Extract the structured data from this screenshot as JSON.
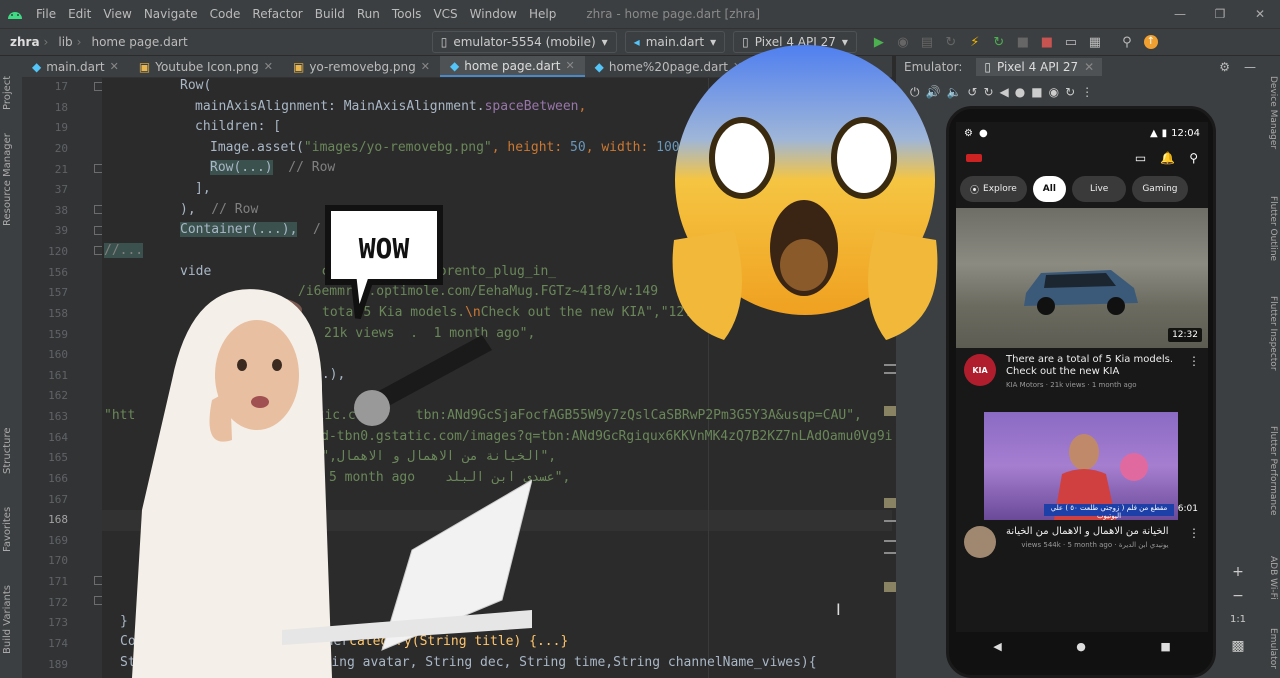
{
  "menubar": {
    "items": [
      "File",
      "Edit",
      "View",
      "Navigate",
      "Code",
      "Refactor",
      "Build",
      "Run",
      "Tools",
      "VCS",
      "Window",
      "Help"
    ],
    "window_title": "zhra - home page.dart [zhra]"
  },
  "navbar": {
    "project": "zhra",
    "folder": "lib",
    "file": "home page.dart",
    "device_selector": "emulator-5554 (mobile)",
    "run_config": "main.dart",
    "avd": "Pixel 4 API 27"
  },
  "tabs": [
    {
      "label": "main.dart",
      "active": false
    },
    {
      "label": "Youtube Icon.png",
      "active": false
    },
    {
      "label": "yo-removebg.png",
      "active": false
    },
    {
      "label": "home page.dart",
      "active": true
    },
    {
      "label": "home%20page.dart",
      "active": false
    }
  ],
  "left_strip": {
    "project": "Project",
    "resource_manager": "Resource Manager",
    "structure": "Structure",
    "favorites": "Favorites",
    "build_variants": "Build Variants"
  },
  "right_strip": {
    "device_manager": "Device Manager",
    "flutter_outline": "Flutter Outline",
    "flutter_inspector": "Flutter Inspector",
    "flutter_performance": "Flutter Performance",
    "adb_wifi": "ADB Wi-Fi",
    "emulator": "Emulator"
  },
  "editor": {
    "line_numbers": [
      "17",
      "18",
      "19",
      "20",
      "21",
      "37",
      "38",
      "39",
      "120",
      "156",
      "157",
      "158",
      "159",
      "160",
      "161",
      "162",
      "163",
      "164",
      "165",
      "166",
      "167",
      "168",
      "169",
      "170",
      "171",
      "172",
      "173",
      "174",
      "189"
    ],
    "current_line": "168",
    "lines": {
      "l17": "Row(",
      "l18_a": "mainAxisAlignment: MainAxisAlignment.",
      "l18_b": "spaceBetween",
      "l18_c": ",",
      "l19": "children: [",
      "l20_a": "Image.asset(",
      "l20_b": "\"images/yo-removebg.png\"",
      "l20_c": ", height: ",
      "l20_d": "50",
      "l20_e": ", width: ",
      "l20_f": "100",
      "l20_g": ")",
      "l21_a": "Row(...)",
      "l21_b": "  // Row",
      "l37": "],",
      "l38_a": "),",
      "l38_b": "  // Row",
      "l39_a": "Container(...),",
      "l39_b": "  /",
      "l120": "//...",
      "l156_a": "vide",
      "l156_b": "com/walls/kia_sorento_plug_in_",
      "l157": "/i6emmr.i.optimole.com/EehaMug.FGTz~41f8/w:149",
      "l158_a": "tota",
      "l158_b": "5 Kia models.",
      "l158_c": "\\n",
      "l158_d": "Check out the new KIA\",\"12.",
      "l159": "21k views  .  1 month ago\",",
      "l161": "0.),",
      "l163_a": "\"htt",
      "l163_b": "gstatic.c",
      "l163_c": "tbn:ANd9GcSjaFocfAGB55W9y7zQslCaSBRwP2Pm3G5Y3A&usqp=CAU\",",
      "l164": "rypted-tbn0.gstatic.com/images?q=tbn:ANd9GcRgiqux6KKVnMK4zQ7B2KZ7nLAdOamu0Vg9iw&u",
      "l165_a": "الخيانة من الاهمال و الاهمال",
      "l165_b": ",\"6:01\",",
      "l166_a": "k  .  5 month ago",
      "l166_b": "عسدي ابن البلد",
      "l166_c": "\",",
      "l172": "}",
      "l173_a": "Co",
      "l173_b": "ner",
      "l173_c": "category(String title) {...}",
      "l174_a": "Stack ",
      "l174_b": "video",
      "l174_c": "(String url ,String avatar, String dec, String time,String channelName_viwes){"
    }
  },
  "emulator": {
    "label": "Emulator:",
    "device_tab": "Pixel 4 API 27",
    "side_zoom": "1:1"
  },
  "phone": {
    "time": "12:04",
    "chips": [
      "Explore",
      "All",
      "Live",
      "Gaming"
    ],
    "video1": {
      "duration": "12:32",
      "title": "There are a total of 5 Kia models. Check out the new KIA",
      "channel": "KIA Motors",
      "views": "21k views",
      "age": "1 month ago"
    },
    "video2": {
      "duration": "6:01",
      "caption": "مقطع من فلم ( زوجتي طلعت ٥٠ ) علي اليوتيوب",
      "title": "الخيانة من الاهمال و الاهمال من الخيانة",
      "channel": "يونيدي ابن الديرة",
      "views": "views 544k",
      "age": "5 month ago"
    }
  },
  "stickers": {
    "wow_text": "WOW"
  },
  "colors": {
    "background": "#2b2b2b",
    "toolbar": "#3c3f41",
    "keyword": "#cc7832",
    "string": "#6a8759",
    "number": "#6897bb",
    "run_green": "#4caf50",
    "stop_red": "#c75450"
  }
}
